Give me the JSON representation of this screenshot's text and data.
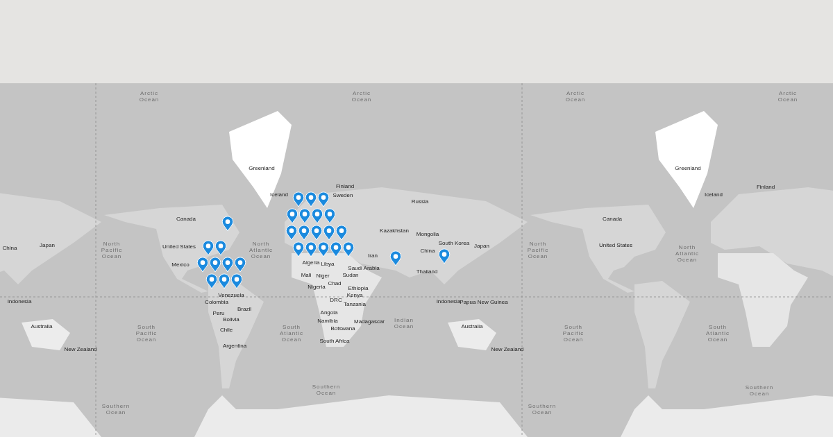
{
  "map": {
    "labels": [
      {
        "kind": "ocean",
        "text": "Arctic Ocean"
      },
      {
        "kind": "ocean",
        "text": "Arctic Ocean"
      },
      {
        "kind": "ocean",
        "text": "Arctic Ocean"
      },
      {
        "kind": "ocean",
        "text": "Arctic Ocean"
      },
      {
        "kind": "ocean",
        "text": "North Pacific Ocean"
      },
      {
        "kind": "ocean",
        "text": "North Atlantic Ocean"
      },
      {
        "kind": "ocean",
        "text": "South Pacific Ocean"
      },
      {
        "kind": "ocean",
        "text": "South Atlantic Ocean"
      },
      {
        "kind": "ocean",
        "text": "Indian Ocean"
      },
      {
        "kind": "ocean",
        "text": "Southern Ocean"
      },
      {
        "kind": "ocean",
        "text": "Southern Ocean"
      },
      {
        "kind": "ocean",
        "text": "North Pacific Ocean"
      },
      {
        "kind": "ocean",
        "text": "North Atlantic Ocean"
      },
      {
        "kind": "ocean",
        "text": "South Pacific Ocean"
      },
      {
        "kind": "ocean",
        "text": "South Atlantic Ocean"
      },
      {
        "kind": "ocean",
        "text": "Southern Ocean"
      },
      {
        "kind": "ocean",
        "text": "Southern Ocean"
      },
      {
        "kind": "place",
        "text": "Greenland"
      },
      {
        "kind": "place",
        "text": "Canada"
      },
      {
        "kind": "place",
        "text": "United States"
      },
      {
        "kind": "place",
        "text": "Mexico"
      },
      {
        "kind": "place",
        "text": "Venezuela"
      },
      {
        "kind": "place",
        "text": "Colombia"
      },
      {
        "kind": "place",
        "text": "Brazil"
      },
      {
        "kind": "place",
        "text": "Peru"
      },
      {
        "kind": "place",
        "text": "Bolivia"
      },
      {
        "kind": "place",
        "text": "Chile"
      },
      {
        "kind": "place",
        "text": "Argentina"
      },
      {
        "kind": "place",
        "text": "Iceland"
      },
      {
        "kind": "place",
        "text": "Finland"
      },
      {
        "kind": "place",
        "text": "Sweden"
      },
      {
        "kind": "place",
        "text": "Russia"
      },
      {
        "kind": "place",
        "text": "Kazakhstan"
      },
      {
        "kind": "place",
        "text": "Mongolia"
      },
      {
        "kind": "place",
        "text": "China"
      },
      {
        "kind": "place",
        "text": "South Korea"
      },
      {
        "kind": "place",
        "text": "Japan"
      },
      {
        "kind": "place",
        "text": "Thailand"
      },
      {
        "kind": "place",
        "text": "Algeria"
      },
      {
        "kind": "place",
        "text": "Libya"
      },
      {
        "kind": "place",
        "text": "Iran"
      },
      {
        "kind": "place",
        "text": "Saudi Arabia"
      },
      {
        "kind": "place",
        "text": "Mali"
      },
      {
        "kind": "place",
        "text": "Niger"
      },
      {
        "kind": "place",
        "text": "Chad"
      },
      {
        "kind": "place",
        "text": "Sudan"
      },
      {
        "kind": "place",
        "text": "Nigeria"
      },
      {
        "kind": "place",
        "text": "Ethiopia"
      },
      {
        "kind": "place",
        "text": "Kenya"
      },
      {
        "kind": "place",
        "text": "DRC"
      },
      {
        "kind": "place",
        "text": "Tanzania"
      },
      {
        "kind": "place",
        "text": "Angola"
      },
      {
        "kind": "place",
        "text": "Namibia"
      },
      {
        "kind": "place",
        "text": "Botswana"
      },
      {
        "kind": "place",
        "text": "Madagascar"
      },
      {
        "kind": "place",
        "text": "South Africa"
      },
      {
        "kind": "place",
        "text": "Indonesia"
      },
      {
        "kind": "place",
        "text": "Papua New Guinea"
      },
      {
        "kind": "place",
        "text": "Australia"
      },
      {
        "kind": "place",
        "text": "New Zealand"
      },
      {
        "kind": "place",
        "text": "Greenland"
      },
      {
        "kind": "place",
        "text": "Canada"
      },
      {
        "kind": "place",
        "text": "United States"
      },
      {
        "kind": "place",
        "text": "Iceland"
      },
      {
        "kind": "place",
        "text": "Finland"
      },
      {
        "kind": "place",
        "text": "China"
      },
      {
        "kind": "place",
        "text": "Japan"
      },
      {
        "kind": "place",
        "text": "Indonesia"
      },
      {
        "kind": "place",
        "text": "Australia"
      },
      {
        "kind": "place",
        "text": "New Zealand"
      }
    ],
    "markers": [
      {
        "kind": "pin"
      },
      {
        "kind": "pin"
      },
      {
        "kind": "pin"
      },
      {
        "kind": "pin"
      },
      {
        "kind": "pin"
      },
      {
        "kind": "pin"
      },
      {
        "kind": "pin"
      },
      {
        "kind": "pin"
      },
      {
        "kind": "pin"
      },
      {
        "kind": "pin"
      },
      {
        "kind": "pin"
      },
      {
        "kind": "pin"
      },
      {
        "kind": "pin"
      },
      {
        "kind": "pin"
      },
      {
        "kind": "pin"
      },
      {
        "kind": "pin"
      },
      {
        "kind": "pin"
      },
      {
        "kind": "pin"
      },
      {
        "kind": "pin"
      },
      {
        "kind": "pin"
      },
      {
        "kind": "pin"
      },
      {
        "kind": "pin"
      },
      {
        "kind": "pin"
      },
      {
        "kind": "pin"
      },
      {
        "kind": "pin"
      },
      {
        "kind": "pin"
      },
      {
        "kind": "pin"
      },
      {
        "kind": "pin"
      },
      {
        "kind": "pin"
      }
    ]
  }
}
